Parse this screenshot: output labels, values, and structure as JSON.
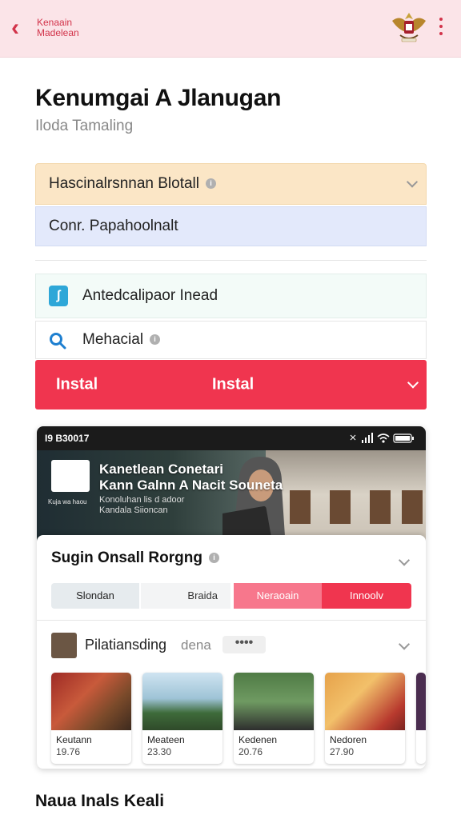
{
  "header": {
    "back_icon": "chevron-left-icon",
    "title": "Kenaain Madelean",
    "accent": "#d2334a",
    "crest_icon": "garuda-crest-icon",
    "menu_icon": "more-vertical-icon"
  },
  "page": {
    "title": "Kenumgai A Jlanugan",
    "subtitle": "Iloda Tamaling"
  },
  "rows": {
    "dropdown1": "Hascinalrsnnan Blotall",
    "field2": "Conr. Papahoolnalt",
    "item3": "Antedcalipaor Inead",
    "item4": "Mehacial",
    "install_left": "Instal",
    "install_center": "Instal"
  },
  "phone": {
    "status_time": "I9 B30017",
    "hero_title_1": "Kanetlean Conetari",
    "hero_title_2": "Kann Galnn A Nacit Souneta",
    "hero_sub_1": "Konoluhan lis d adoor",
    "hero_sub_2": "Kandala Siioncan",
    "hero_thumb_caption": "Kuja wa haou",
    "card_title": "Sugin Onsall Rorgng",
    "segments": [
      "Slondan",
      "Braida",
      "Neraoain",
      "Innoolv"
    ],
    "profile_name": "Pilatiansding",
    "profile_tag": "dena",
    "dots": "••••",
    "tiles": [
      {
        "name": "Keutann",
        "price": "19.76"
      },
      {
        "name": "Meateen",
        "price": "23.30"
      },
      {
        "name": "Kedenen",
        "price": "20.76"
      },
      {
        "name": "Nedoren",
        "price": "27.90"
      }
    ]
  },
  "footer": {
    "label": "Naua Inals Keali"
  }
}
